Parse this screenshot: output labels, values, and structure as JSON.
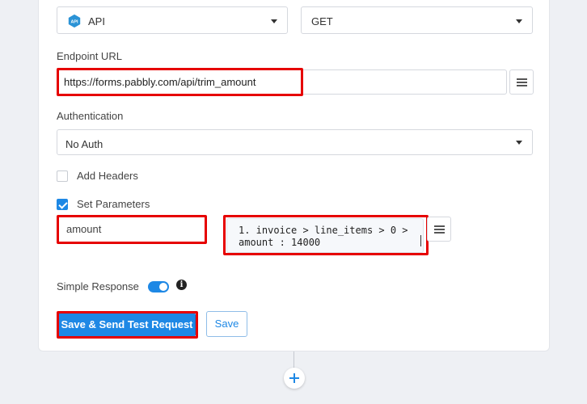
{
  "app_select": {
    "value": "API",
    "icon": "api-icon"
  },
  "method_select": {
    "value": "GET"
  },
  "endpoint": {
    "label": "Endpoint URL",
    "value": "https://forms.pabbly.com/api/trim_amount"
  },
  "authentication": {
    "label": "Authentication",
    "value": "No Auth"
  },
  "add_headers": {
    "label": "Add Headers",
    "checked": false
  },
  "set_parameters": {
    "label": "Set Parameters",
    "checked": true,
    "param_key": "amount",
    "param_value_line1": "1. invoice > line_items > 0 >",
    "param_value_line2": "amount : 14000"
  },
  "simple_response": {
    "label": "Simple Response",
    "enabled": true,
    "info": "i"
  },
  "buttons": {
    "save_send": "Save & Send Test Request",
    "save": "Save"
  },
  "colors": {
    "accent": "#1e88e5",
    "highlight": "#e60000"
  }
}
